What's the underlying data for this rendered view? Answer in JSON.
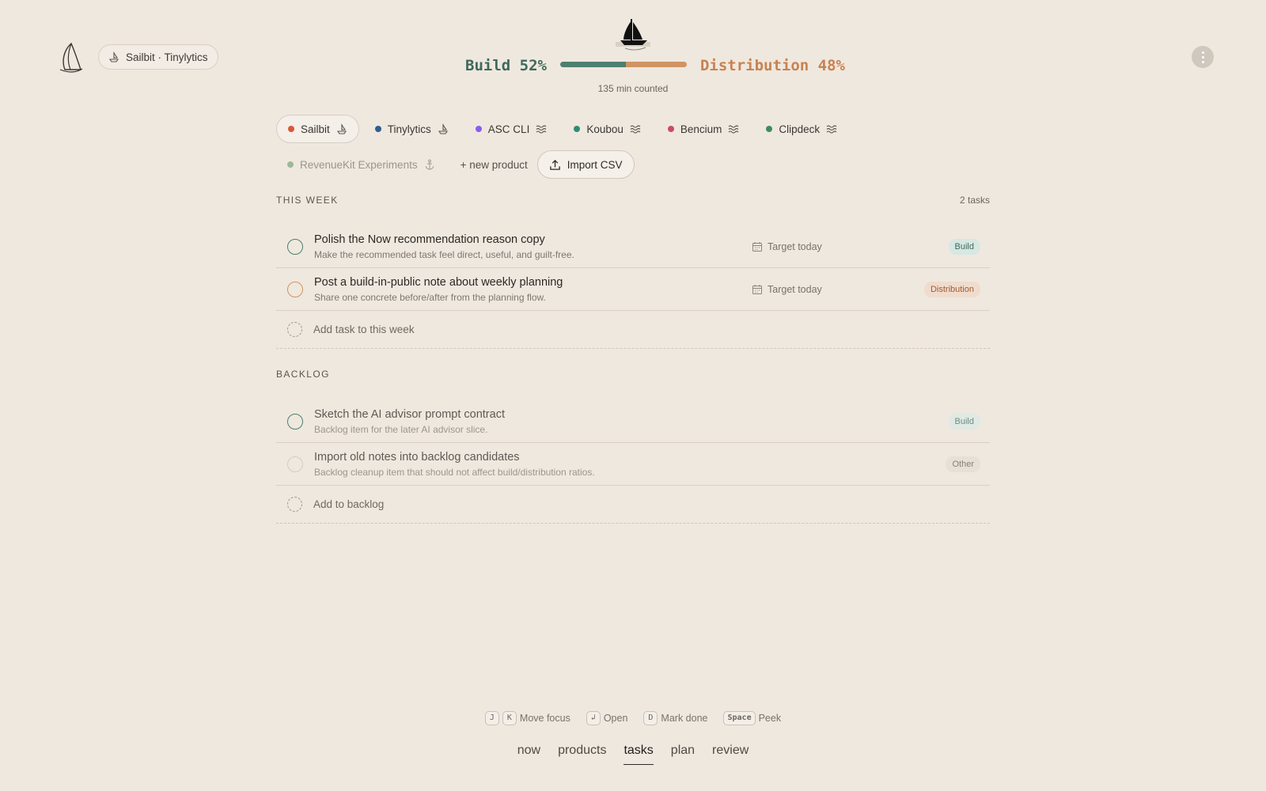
{
  "header": {
    "breadcrumb": "Sailbit · Tinylytics",
    "build_label": "Build 52%",
    "distribution_label": "Distribution 48%",
    "build_fraction": 0.52,
    "counted": "135 min counted",
    "colors": {
      "build": "#4f7f70",
      "distribution": "#cf9463"
    }
  },
  "products": [
    {
      "name": "Sailbit",
      "color": "#d9573a",
      "icon": "boat-icon",
      "active": true
    },
    {
      "name": "Tinylytics",
      "color": "#2f5e8e",
      "icon": "boat-icon",
      "active": false
    },
    {
      "name": "ASC CLI",
      "color": "#8a5cf0",
      "icon": "waves-icon",
      "active": false
    },
    {
      "name": "Koubou",
      "color": "#2e8c76",
      "icon": "waves-icon",
      "active": false
    },
    {
      "name": "Bencium",
      "color": "#cc4a6a",
      "icon": "waves-icon",
      "active": false
    },
    {
      "name": "Clipdeck",
      "color": "#3f8a5e",
      "icon": "waves-icon",
      "active": false
    },
    {
      "name": "RevenueKit Experiments",
      "color": "#9fb894",
      "icon": "anchor-icon",
      "active": false,
      "muted": true
    }
  ],
  "actions": {
    "new_product": "+ new product",
    "import_csv": "Import CSV"
  },
  "this_week": {
    "title": "THIS WEEK",
    "count": "2 tasks",
    "tasks": [
      {
        "title": "Polish the Now recommendation reason copy",
        "subtitle": "Make the recommended task feel direct, useful, and guilt-free.",
        "target": "Target today",
        "tag": "Build"
      },
      {
        "title": "Post a build-in-public note about weekly planning",
        "subtitle": "Share one concrete before/after from the planning flow.",
        "target": "Target today",
        "tag": "Distribution"
      }
    ],
    "add_label": "Add task to this week"
  },
  "backlog": {
    "title": "BACKLOG",
    "tasks": [
      {
        "title": "Sketch the AI advisor prompt contract",
        "subtitle": "Backlog item for the later AI advisor slice.",
        "tag": "Build"
      },
      {
        "title": "Import old notes into backlog candidates",
        "subtitle": "Backlog cleanup item that should not affect build/distribution ratios.",
        "tag": "Other"
      }
    ],
    "add_label": "Add to backlog"
  },
  "shortcuts": {
    "j": "J",
    "k": "K",
    "move_focus": "Move focus",
    "enter": "↲",
    "open": "Open",
    "d": "D",
    "mark_done": "Mark done",
    "space": "Space",
    "peek": "Peek"
  },
  "nav": {
    "now": "now",
    "products": "products",
    "tasks": "tasks",
    "plan": "plan",
    "review": "review"
  }
}
